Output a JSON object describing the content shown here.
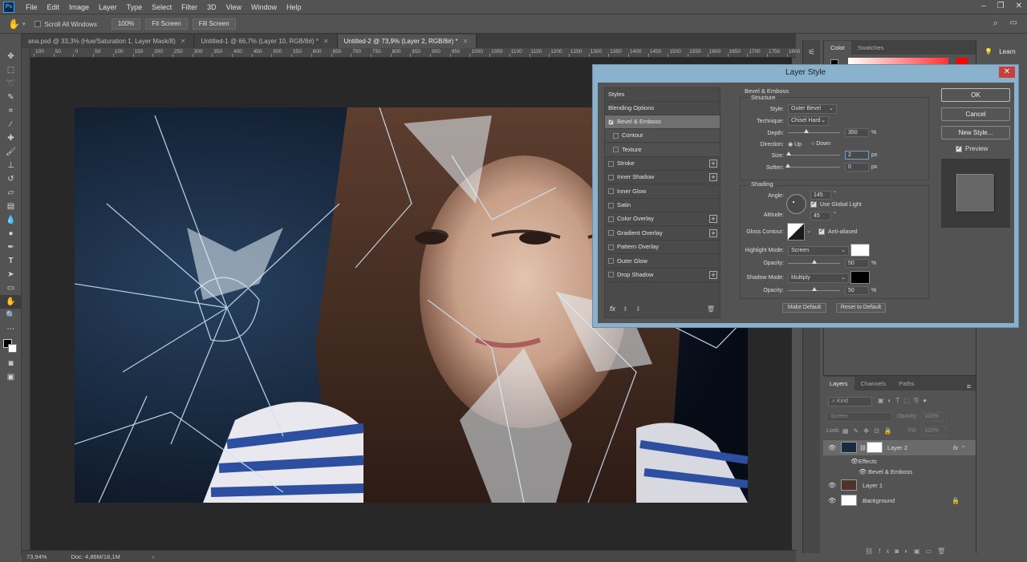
{
  "app": {
    "logo": "Ps",
    "menu": [
      "File",
      "Edit",
      "Image",
      "Layer",
      "Type",
      "Select",
      "Filter",
      "3D",
      "View",
      "Window",
      "Help"
    ]
  },
  "options": {
    "scroll_all_windows": "Scroll All Windows",
    "zoom_100": "100%",
    "fit_screen": "Fit Screen",
    "fill_screen": "Fill Screen"
  },
  "tabs": [
    {
      "label": "ana.psd @ 33,3% (Hue/Saturation 1, Layer Mask/8)"
    },
    {
      "label": "Untitled-1 @ 66,7% (Layer 10, RGB/8#) *"
    },
    {
      "label": "Untitled-2 @ 73,9% (Layer 2, RGB/8#) *"
    }
  ],
  "ruler": [
    "100",
    "50",
    "0",
    "50",
    "100",
    "150",
    "200",
    "250",
    "300",
    "350",
    "400",
    "450",
    "500",
    "550",
    "600",
    "650",
    "700",
    "750",
    "800",
    "850",
    "900",
    "950",
    "1000",
    "1050",
    "1100",
    "1150",
    "1200",
    "1250",
    "1300",
    "1350",
    "1400",
    "1450",
    "1500",
    "1550",
    "1600",
    "1650",
    "1700",
    "1750",
    "1800"
  ],
  "status": {
    "zoom": "73,94%",
    "doc": "Doc: 4,86M/18,1M"
  },
  "right_panel": {
    "color_tab": "Color",
    "swatches_tab": "Swatches",
    "learn": "Learn",
    "layers_tab": "Layers",
    "channels_tab": "Channels",
    "paths_tab": "Paths",
    "kind": "Kind",
    "blend": "Screen",
    "opacity_label": "Opacity:",
    "opacity_value": "100%",
    "lock_label": "Lock:",
    "fill_label": "Fill:",
    "fill_value": "100%",
    "layers": [
      {
        "name": "Layer 2"
      },
      {
        "name": "Effects"
      },
      {
        "name": "Bevel & Emboss"
      },
      {
        "name": "Layer 1"
      },
      {
        "name": "Background"
      }
    ]
  },
  "dialog": {
    "title": "Layer Style",
    "close": "✕",
    "styles_header": "Styles",
    "blending_options": "Blending Options",
    "styles": [
      {
        "label": "Bevel & Emboss",
        "checked": true,
        "plus": false
      },
      {
        "label": "Contour",
        "checked": false,
        "plus": false
      },
      {
        "label": "Texture",
        "checked": false,
        "plus": false
      },
      {
        "label": "Stroke",
        "checked": false,
        "plus": true
      },
      {
        "label": "Inner Shadow",
        "checked": false,
        "plus": true
      },
      {
        "label": "Inner Glow",
        "checked": false,
        "plus": false
      },
      {
        "label": "Satin",
        "checked": false,
        "plus": false
      },
      {
        "label": "Color Overlay",
        "checked": false,
        "plus": true
      },
      {
        "label": "Gradient Overlay",
        "checked": false,
        "plus": true
      },
      {
        "label": "Pattern Overlay",
        "checked": false,
        "plus": false
      },
      {
        "label": "Outer Glow",
        "checked": false,
        "plus": false
      },
      {
        "label": "Drop Shadow",
        "checked": false,
        "plus": true
      }
    ],
    "fx": "fx",
    "bevel_title": "Bevel & Emboss",
    "structure_title": "Structure",
    "style_label": "Style:",
    "style_value": "Outer Bevel",
    "technique_label": "Technique:",
    "technique_value": "Chisel Hard",
    "depth_label": "Depth:",
    "depth_value": "350",
    "depth_unit": "%",
    "direction_label": "Direction:",
    "dir_up": "Up",
    "dir_down": "Down",
    "size_label": "Size:",
    "size_value": "2",
    "size_unit": "px",
    "soften_label": "Soften:",
    "soften_value": "0",
    "soften_unit": "px",
    "shading_title": "Shading",
    "angle_label": "Angle:",
    "angle_value": "145",
    "deg": "°",
    "global_light": "Use Global Light",
    "altitude_label": "Altitude:",
    "altitude_value": "45",
    "gloss_label": "Gloss Contour:",
    "anti_aliased": "Anti-aliased",
    "highlight_label": "Highlight Mode:",
    "highlight_value": "Screen",
    "opacity_label": "Opacity:",
    "highlight_opacity": "50",
    "shadow_label": "Shadow Mode:",
    "shadow_value": "Multiply",
    "shadow_opacity": "50",
    "pct": "%",
    "make_default": "Make Default",
    "reset_default": "Reset to Default",
    "ok": "OK",
    "cancel": "Cancel",
    "new_style": "New Style...",
    "preview": "Preview"
  }
}
